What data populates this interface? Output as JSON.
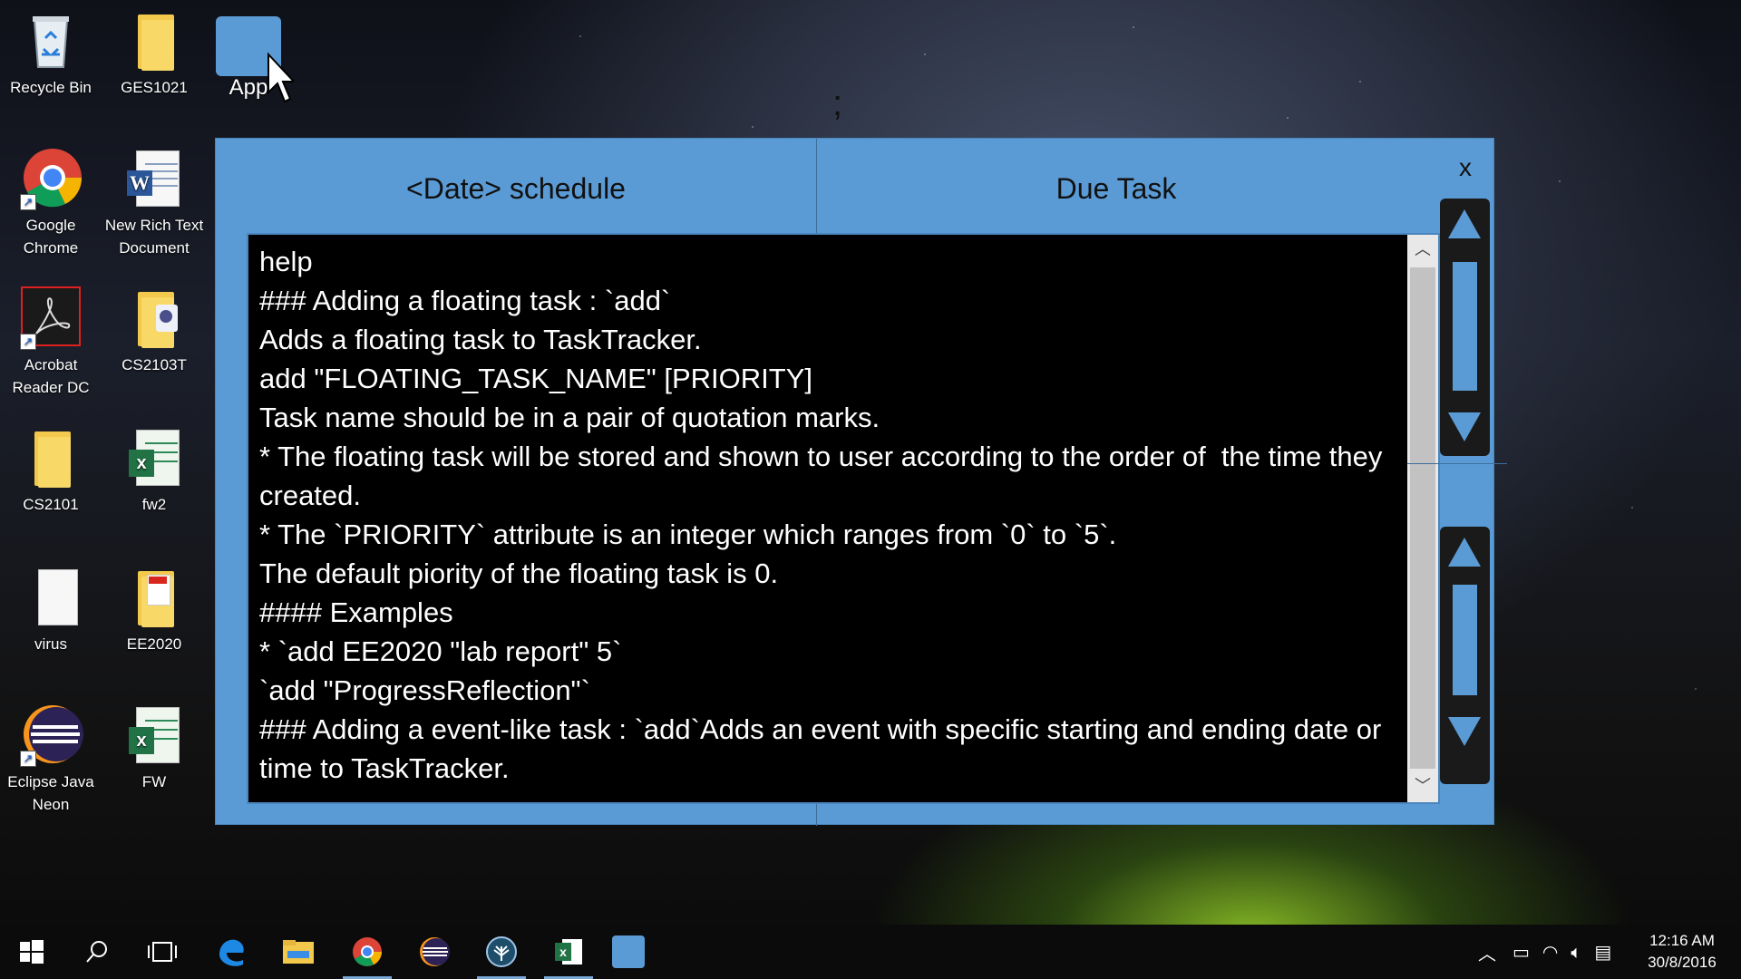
{
  "desktop": {
    "icons": [
      {
        "label": "Recycle Bin"
      },
      {
        "label": "GES1021"
      },
      {
        "label": "App"
      },
      {
        "label": "Google Chrome"
      },
      {
        "label": "New Rich Text Document"
      },
      {
        "label": "Acrobat Reader DC"
      },
      {
        "label": "CS2103T"
      },
      {
        "label": "CS2101"
      },
      {
        "label": "fw2"
      },
      {
        "label": "virus"
      },
      {
        "label": "EE2020"
      },
      {
        "label": "Eclipse Java Neon"
      },
      {
        "label": "FW"
      }
    ],
    "stray_text": ";"
  },
  "window": {
    "left_title": "<Date> schedule",
    "right_title": "Due Task",
    "close_label": "x",
    "console_lines": [
      "help",
      "### Adding a floating task : `add`",
      "Adds a floating task to TaskTracker.",
      "add \"FLOATING_TASK_NAME\" [PRIORITY]",
      "Task name should be in a pair of quotation marks.",
      "* The floating task will be stored and shown to user according to the order of  the time they created.",
      "* The `PRIORITY` attribute is an integer which ranges from `0` to `5`.",
      "The default piority of the floating task is 0.",
      "#### Examples",
      "* `add EE2020 \"lab report\" 5`",
      "`add \"ProgressReflection\"`",
      "### Adding a event-like task : `add`Adds an event with specific starting and ending date or time to TaskTracker."
    ]
  },
  "taskbar": {
    "items": [
      "start",
      "search",
      "task-view",
      "edge",
      "file-explorer",
      "chrome",
      "eclipse",
      "app-tree",
      "excel",
      "app"
    ],
    "time": "12:16 AM",
    "date": "30/8/2016"
  },
  "colors": {
    "window_bg": "#5b9bd5",
    "console_bg": "#000000",
    "taskbar_bg": "#0b0b0b"
  }
}
